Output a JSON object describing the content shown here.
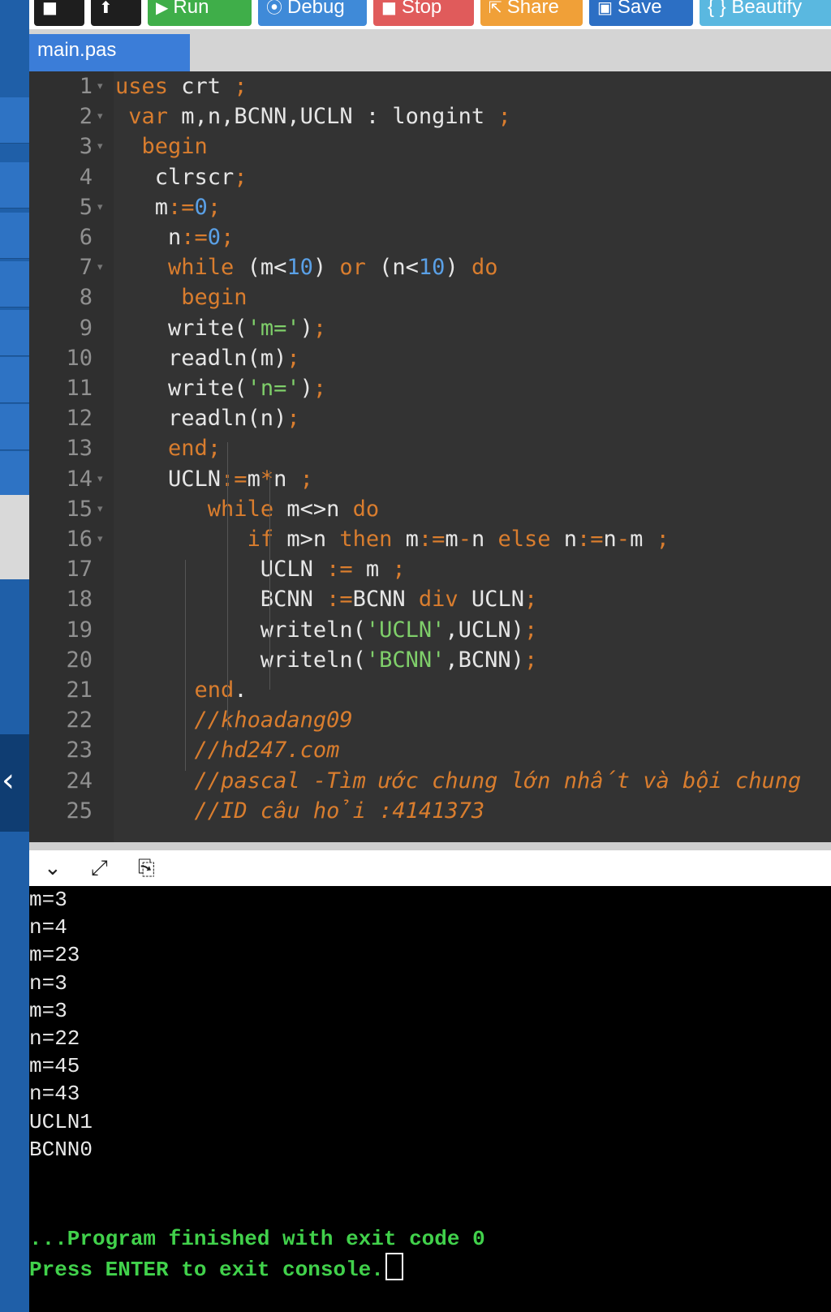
{
  "toolbar": {
    "buttons": [
      {
        "label": "",
        "icon": "file-icon",
        "glyph": "■",
        "color": "#1e1e1e"
      },
      {
        "label": "",
        "icon": "upload-icon",
        "glyph": "⬆",
        "color": "#1e1e1e"
      },
      {
        "label": "Run",
        "icon": "play-icon",
        "glyph": "▶",
        "color": "#3fae49"
      },
      {
        "label": "Debug",
        "icon": "debug-icon",
        "glyph": "⦿",
        "color": "#3f8ad8"
      },
      {
        "label": "Stop",
        "icon": "stop-icon",
        "glyph": "■",
        "color": "#e05b5b"
      },
      {
        "label": "Share",
        "icon": "share-icon",
        "glyph": "⇱",
        "color": "#f0a038"
      },
      {
        "label": "Save",
        "icon": "save-icon",
        "glyph": "▣",
        "color": "#2c6fc4"
      },
      {
        "label": "{ } Beautify",
        "icon": "beautify-icon",
        "glyph": "",
        "color": "#5ab8e0"
      }
    ]
  },
  "tab": {
    "label": "main.pas"
  },
  "editor": {
    "line_numbers": [
      "1",
      "2",
      "3",
      "4",
      "5",
      "6",
      "7",
      "8",
      "9",
      "10",
      "11",
      "12",
      "13",
      "14",
      "15",
      "16",
      "17",
      "18",
      "19",
      "20",
      "21",
      "22",
      "23",
      "24",
      "25"
    ],
    "lines": [
      "uses crt ;",
      " var m,n,BCNN,UCLN : longint ;",
      "  begin",
      "   clrscr;",
      "   m:=0;",
      "    n:=0;",
      "    while (m<10) or (n<10) do",
      "     begin",
      "    write('m=');",
      "    readln(m);",
      "    write('n=');",
      "    readln(n);",
      "    end;",
      "    UCLN:=m*n ;",
      "       while m<>n do",
      "          if m>n then m:=m-n else n:=n-m ;",
      "           UCLN := m ;",
      "           BCNN :=BCNN div UCLN;",
      "           writeln('UCLN',UCLN);",
      "           writeln('BCNN',BCNN);",
      "      end.",
      "      //khoadang09",
      "      //hd247.com",
      "      //pascal -Tìm ước chung lớn nhất và bội chung",
      "      //ID câu hỏi :4141373"
    ]
  },
  "console_tools": [
    {
      "icon": "chevron-down-icon",
      "glyph": "⌄"
    },
    {
      "icon": "expand-icon",
      "glyph": "⤢"
    },
    {
      "icon": "copy-icon",
      "glyph": "⎘"
    }
  ],
  "console": {
    "lines": [
      "m=3",
      "n=4",
      "m=23",
      "n=3",
      "m=3",
      "n=22",
      "m=45",
      "n=43",
      "UCLN1",
      "BCNN0"
    ],
    "finished": "...Program finished with exit code 0",
    "prompt": "Press ENTER to exit console."
  },
  "sidebar": {
    "collapse_glyph": "‹"
  }
}
